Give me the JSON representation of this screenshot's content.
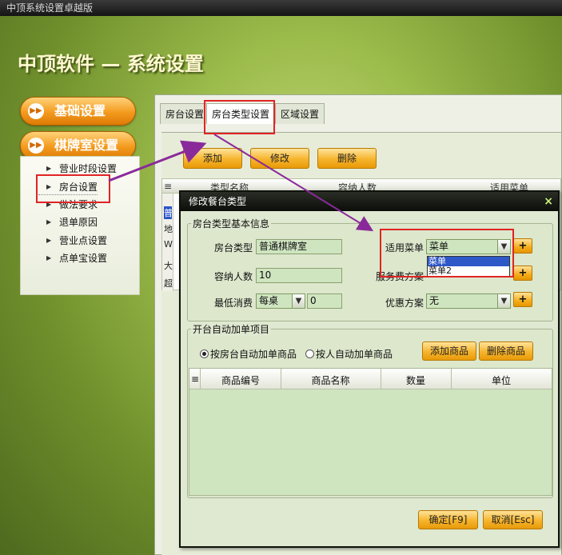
{
  "window": {
    "title": "中顶系统设置卓越版"
  },
  "banner": {
    "text": "中顶软件 — 系统设置"
  },
  "nav": {
    "basic": {
      "label": "基础设置",
      "icon": "fast-forward-icon"
    },
    "chess": {
      "label": "棋牌室设置",
      "icon": "fast-forward-icon"
    },
    "items": [
      "营业时段设置",
      "房台设置",
      "做法要求",
      "退单原因",
      "营业点设置",
      "点单宝设置"
    ]
  },
  "tabs": [
    "房台设置",
    "房台类型设置",
    "区域设置"
  ],
  "toolbar": {
    "add": "添加",
    "edit": "修改",
    "delete": "删除"
  },
  "bg_table": {
    "headers": [
      "类型名称",
      "容纳人数",
      "适用菜单"
    ],
    "row_chars": [
      "普",
      "地",
      "W",
      "大",
      "超"
    ]
  },
  "modal": {
    "title": "修改餐台类型",
    "close": "×",
    "basic": {
      "legend": "房台类型基本信息",
      "type_label": "房台类型",
      "type_value": "普通棋牌室",
      "capacity_label": "容纳人数",
      "capacity_value": "10",
      "min_label": "最低消费",
      "min_mode": "每桌",
      "min_value": "0",
      "menu_label": "适用菜单",
      "menu_value": "菜单",
      "menu_options": [
        "菜单",
        "菜单2"
      ],
      "service_label": "服务费方案",
      "discount_label": "优惠方案",
      "discount_value": "无",
      "plus": "+"
    },
    "auto": {
      "legend": "开台自动加单项目",
      "radio1": "按房台自动加单商品",
      "radio2": "按人自动加单商品",
      "add_btn": "添加商品",
      "del_btn": "删除商品",
      "grid_headers": [
        "商品编号",
        "商品名称",
        "数量",
        "单位"
      ]
    },
    "ok": "确定[F9]",
    "cancel": "取消[Esc]"
  },
  "colors": {
    "highlight_red": "#e02424",
    "arrow_purple": "#8a2a9a",
    "accent_orange": "#f39a1e"
  }
}
